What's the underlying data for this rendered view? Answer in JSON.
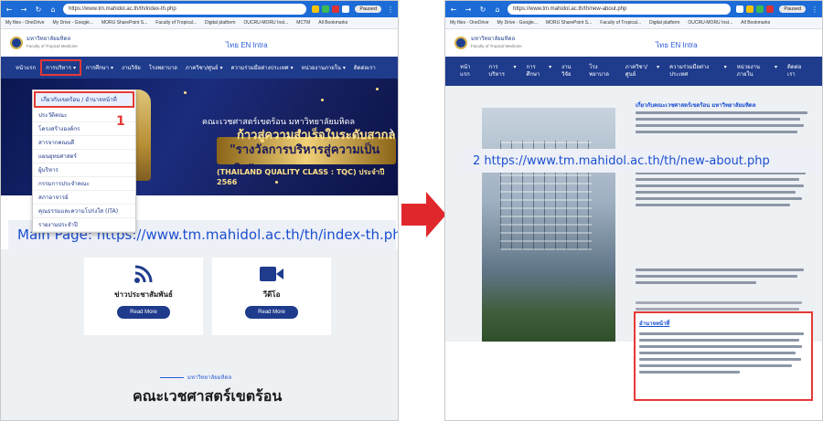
{
  "colors": {
    "browser_chrome": "#1c6bd6",
    "nav_blue": "#1e3b8c",
    "accent_red": "#e53935",
    "link_blue": "#1a4fd0",
    "banner_gold": "#ffe28a"
  },
  "left_window": {
    "url": "https://www.tm.mahidol.ac.th/th/index-th.php",
    "profile": "Paused",
    "bookmarks": [
      "My files - OneDrive",
      "My Drive - Google...",
      "MORU SharePoint S...",
      "Faculty of Tropical...",
      "Digital platform",
      "OUCRU-MORU Inst...",
      "MCTM",
      "All Bookmarks"
    ],
    "site": {
      "logo_text": "มหาวิทยาลัยมหิดล",
      "logo_sub": "Faculty of Tropical Medicine",
      "lang": "ไทย  EN  Intra"
    },
    "nav": [
      "หน้าแรก",
      "การบริหาร",
      "การศึกษา",
      "งานวิจัย",
      "โรงพยาบาล",
      "ภาควิชา/ศูนย์",
      "ความร่วมมือต่างประเทศ",
      "หน่วยงานภายใน",
      "ติดต่อเรา"
    ],
    "dropdown": [
      "เกี่ยวกับเขตร้อน / อำนาจหน้าที่",
      "ประวัติคณะ",
      "โครงสร้างองค์กร",
      "สารจากคณบดี",
      "แผนยุทธศาสตร์",
      "ผู้บริหาร",
      "กรรมการประจำคณะ",
      "สภาอาจารย์",
      "คุณธรรมและความโปร่งใส (ITA)",
      "รายงานประจำปี"
    ],
    "marker": "1",
    "banner": {
      "line1": "คณะเวชศาสตร์เขตร้อน มหาวิทยาลัยมหิดล",
      "line2": "ก้าวสู่ความสำเร็จในระดับสากล",
      "line3": "\"รางวัลการบริหารสู่ความเป็นเลิศ\"",
      "line4": "(THAILAND QUALITY CLASS : TQC) ประจำปี 2566",
      "next_arrow": "›"
    },
    "caption": "Main Page: https://www.tm.mahidol.ac.th/th/index-th.php",
    "cards": [
      {
        "title": "ข่าวประชาสัมพันธ์",
        "button": "Read More"
      },
      {
        "title": "วีดีโอ",
        "button": "Read More"
      }
    ],
    "bottom_kicker": "มหาวิทยาลัยมหิดล",
    "bottom_title": "คณะเวชศาสตร์เขตร้อน"
  },
  "right_window": {
    "url": "https://www.tm.mahidol.ac.th/th/new-about.php",
    "profile": "Paused",
    "bookmarks": [
      "My files - OneDrive",
      "My Drive - Google...",
      "MORU SharePoint S...",
      "Faculty of Tropical...",
      "Digital platform",
      "OUCRU-MORU Inst...",
      "All Bookmarks"
    ],
    "site": {
      "logo_text": "มหาวิทยาลัยมหิดล",
      "logo_sub": "Faculty of Tropical Medicine",
      "lang": "ไทย  EN  Intra"
    },
    "nav": [
      "หน้าแรก",
      "การบริหาร",
      "การศึกษา",
      "งานวิจัย",
      "โรงพยาบาล",
      "ภาควิชา/ศูนย์",
      "ความร่วมมือต่างประเทศ",
      "หน่วยงานภายใน",
      "ติดต่อเรา"
    ],
    "heading": "เกี่ยวกับคณะเวชศาสตร์เขตร้อน มหาวิทยาลัยมหิดล",
    "caption": "2 https://www.tm.mahidol.ac.th/th/new-about.php",
    "authority_heading": "อำนาจหน้าที่"
  }
}
